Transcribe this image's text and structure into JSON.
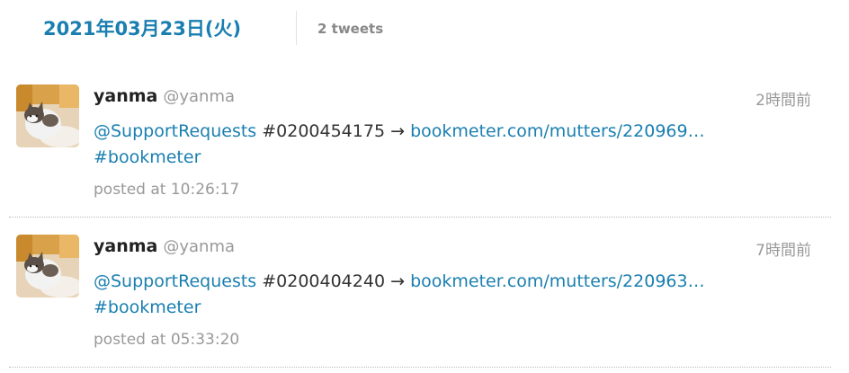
{
  "day": {
    "date": "2021年03月23日(火)",
    "count": "2 tweets"
  },
  "tweets": [
    {
      "user_name": "yanma",
      "screen_name": "@yanma",
      "relative_time": "2時間前",
      "mention": "@SupportRequests",
      "number": "#0200454175",
      "arrow": "→",
      "link": "bookmeter.com/mutters/220969…",
      "hashtag": "#bookmeter",
      "posted": "posted at 10:26:17"
    },
    {
      "user_name": "yanma",
      "screen_name": "@yanma",
      "relative_time": "7時間前",
      "mention": "@SupportRequests",
      "number": "#0200404240",
      "arrow": "→",
      "link": "bookmeter.com/mutters/220963…",
      "hashtag": "#bookmeter",
      "posted": "posted at 05:33:20"
    }
  ],
  "icons": {
    "avatar": "cat-avatar-icon"
  },
  "colors": {
    "accent": "#1a7fb0",
    "muted": "#999999",
    "text": "#333333"
  }
}
